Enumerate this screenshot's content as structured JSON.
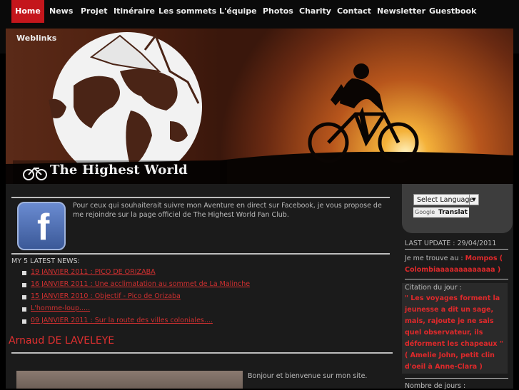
{
  "nav": {
    "items": [
      "Home",
      "News",
      "Projet",
      "Itinéraire",
      "Les sommets",
      "L'équipe",
      "Photos",
      "Charity",
      "Contact",
      "Newsletter",
      "Guestbook"
    ],
    "row2": "Weblinks"
  },
  "banner": {
    "logo_text": "The Highest World"
  },
  "facebook": {
    "text": "Pour ceux qui souhaiterait suivre mon Aventure en direct sur Facebook, je vous propose de me rejoindre sur la page officiel de The Highest World Fan Club."
  },
  "news": {
    "heading": "MY 5 LATEST NEWS:",
    "items": [
      "19 JANVIER 2011 : PICO DE ORIZABA",
      "16 JANVIER 2011 : Une acclimatation au sommet de La Malinche",
      "15 JANVIER 2010 : Objectif - Pico de Orizaba",
      "L'homme-loup.....",
      "09 JANVIER 2011 : Sur la route des villes coloniales...."
    ]
  },
  "author": {
    "name": "Arnaud DE LAVELEYE",
    "welcome": "Bonjour et bienvenue sur mon site."
  },
  "sidebar": {
    "language_select": "Select Language",
    "google_brand": "Google",
    "translate_label": "Translat",
    "last_update": "LAST UPDATE : 29/04/2011",
    "location_label": "Je me trouve au :",
    "location_value": "Mompos ( Colombiaaaaaaaaaaaaa )",
    "quote_label": "Citation du jour :",
    "quote_value": "\" Les voyages forment la jeunesse a dit un sage, mais, rajoute je ne sais quel observateur, ils déforment les chapeaux \" ( Amelie John, petit clin d'oeil à Anne-Clara )",
    "days_label": "Nombre de jours :"
  },
  "colors": {
    "accent": "#c4161c",
    "link": "#d03030",
    "background": "#1b1b1b"
  }
}
